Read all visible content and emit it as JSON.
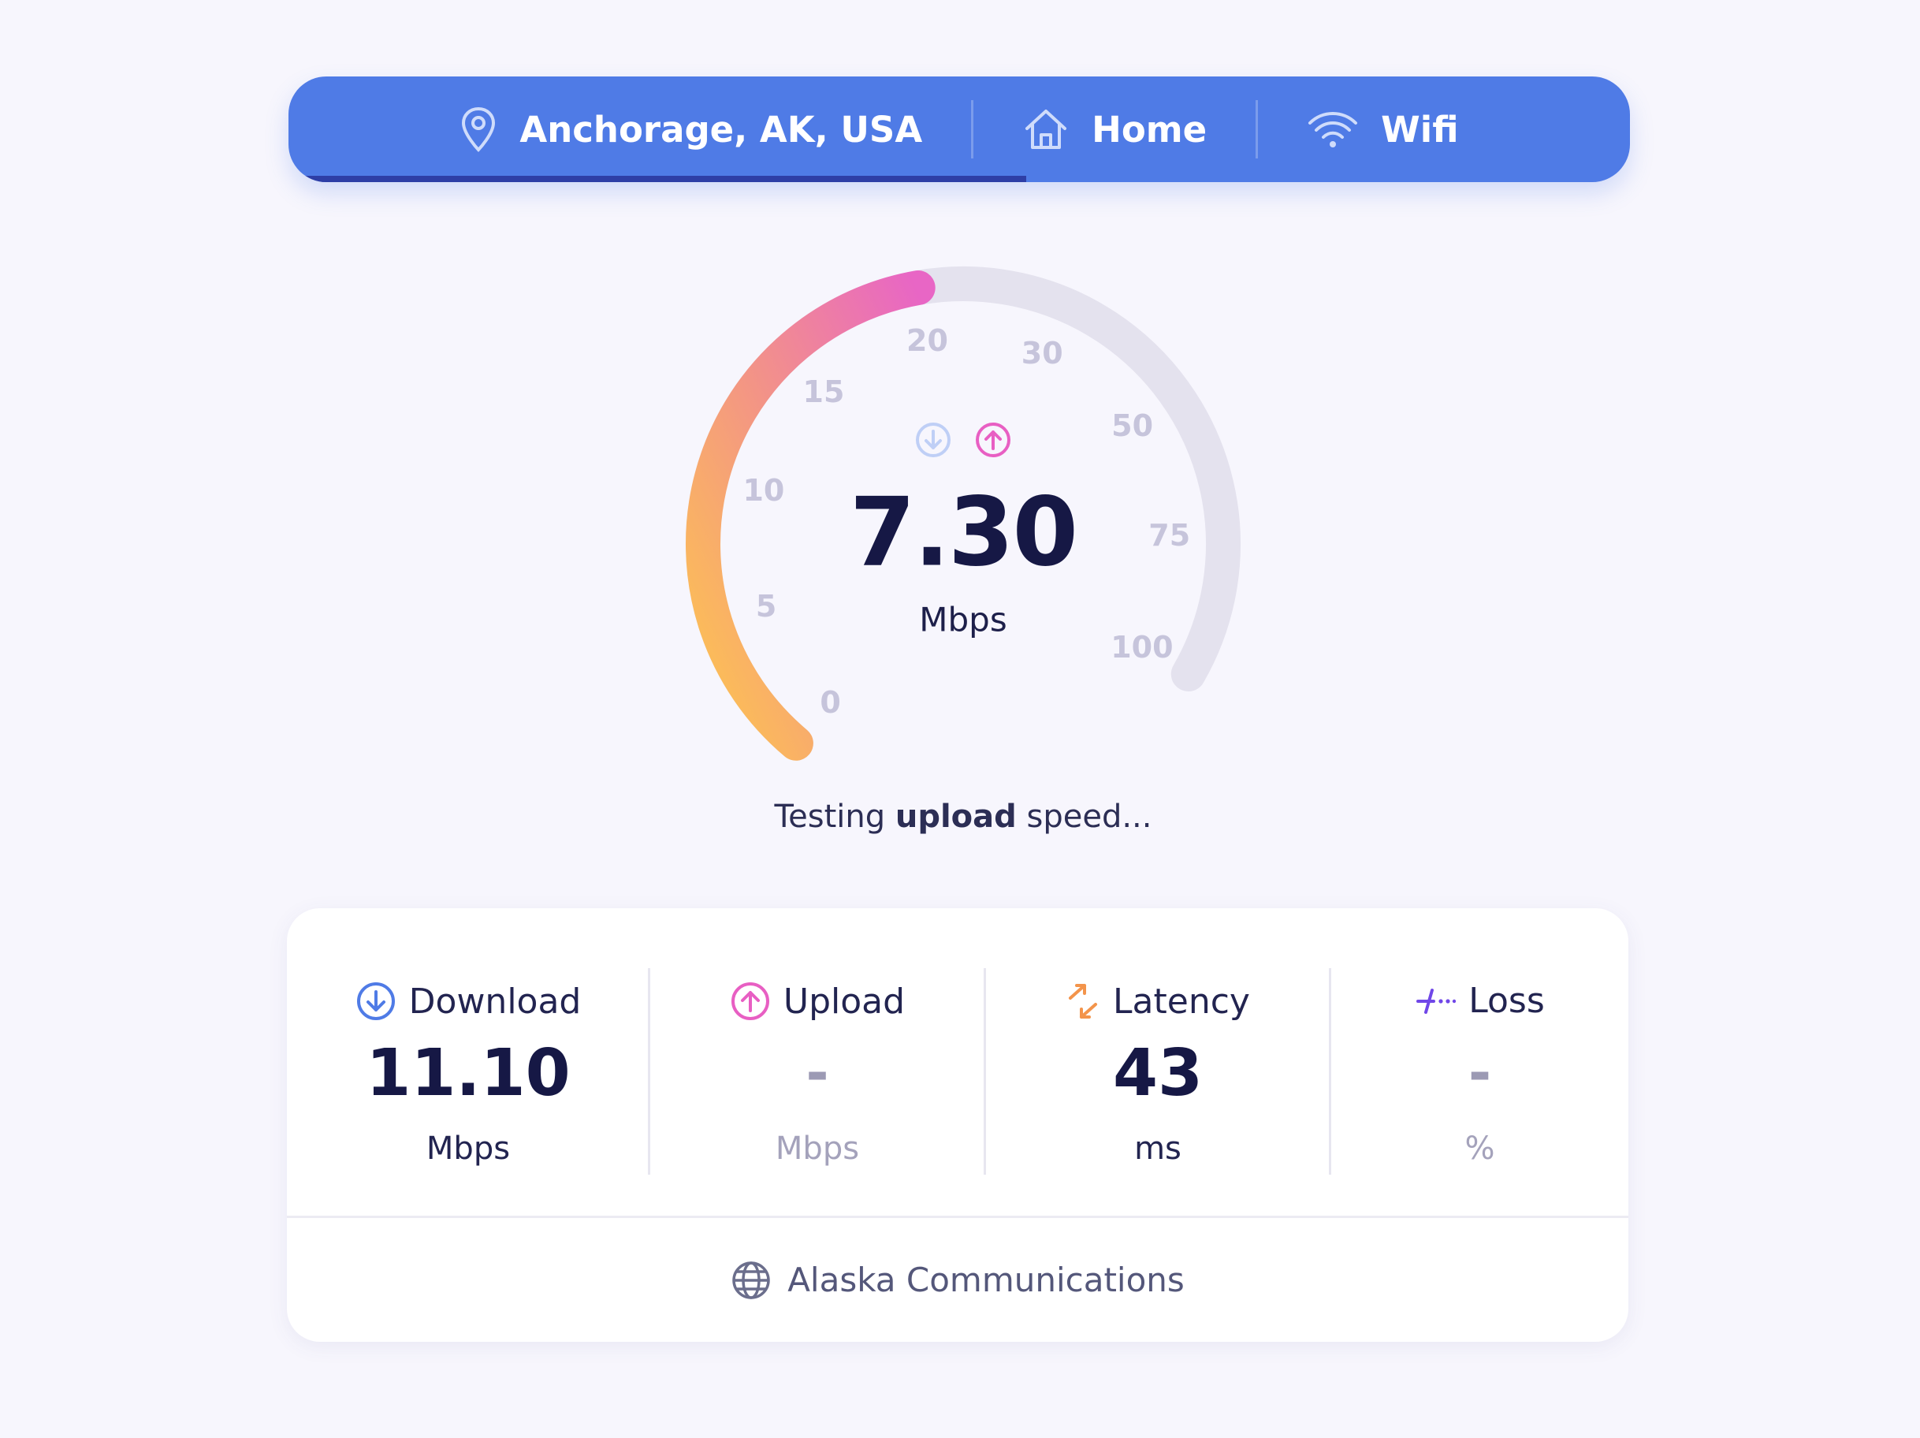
{
  "header": {
    "location": "Anchorage, AK, USA",
    "connection_place": "Home",
    "connection_type": "Wifi",
    "test_progress": 0.55,
    "colors": {
      "pill": "#4f7be6",
      "progress": "#2e3ea6"
    }
  },
  "gauge": {
    "value": "7.30",
    "unit": "Mbps",
    "current_value_numeric": 20,
    "scale_labels": [
      "0",
      "5",
      "10",
      "15",
      "20",
      "30",
      "50",
      "75",
      "100"
    ],
    "gradient": [
      "#ffc446",
      "#f4917f",
      "#e85fc3"
    ],
    "track_color": "#e4e2ee",
    "icons": {
      "download": "download-arrow-icon",
      "upload": "upload-arrow-icon"
    }
  },
  "status": {
    "prefix": "Testing ",
    "emphasis": "upload",
    "suffix": " speed..."
  },
  "metrics": {
    "download": {
      "label": "Download",
      "value": "11.10",
      "unit": "Mbps",
      "icon": "download-arrow-icon",
      "color": "#4f7be6"
    },
    "upload": {
      "label": "Upload",
      "value": "-",
      "unit": "Mbps",
      "icon": "upload-arrow-icon",
      "color": "#e85fc3"
    },
    "latency": {
      "label": "Latency",
      "value": "43",
      "unit": "ms",
      "icon": "latency-arrows-icon",
      "color": "#f3944b"
    },
    "loss": {
      "label": "Loss",
      "value": "-",
      "unit": "%",
      "icon": "packet-loss-icon",
      "color": "#7047e8"
    }
  },
  "isp": {
    "name": "Alaska Communications",
    "icon": "globe-icon"
  }
}
